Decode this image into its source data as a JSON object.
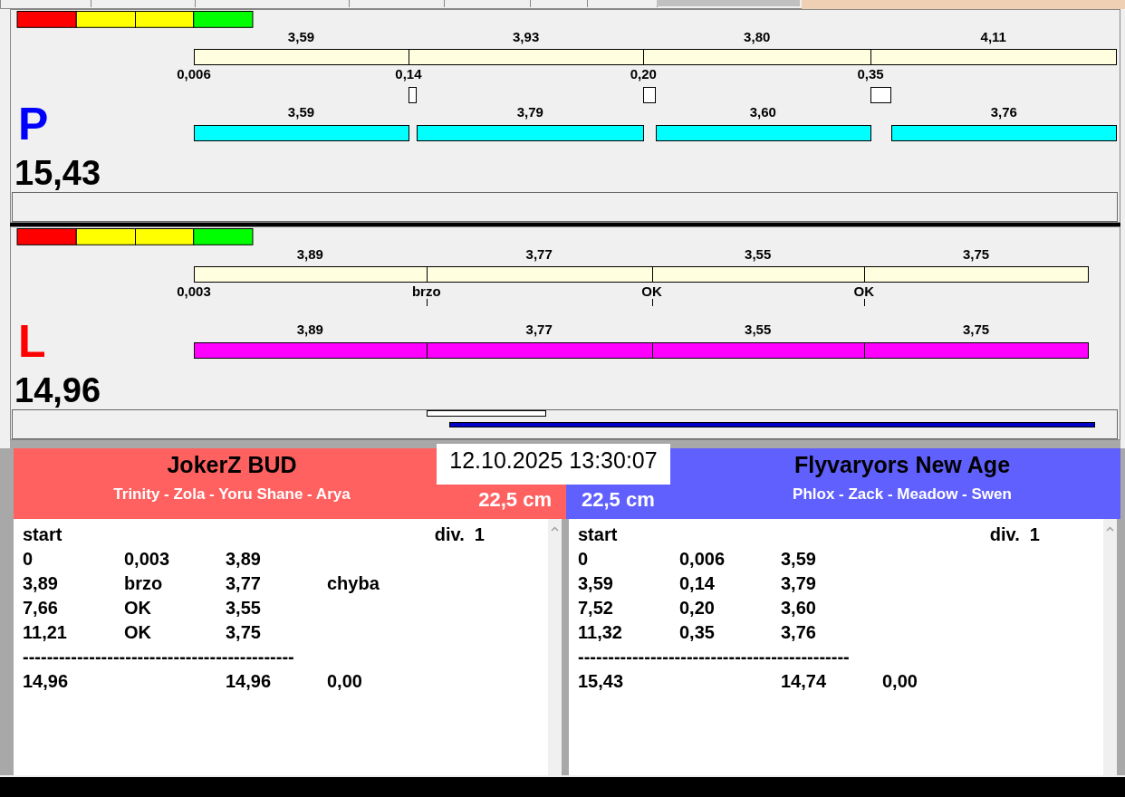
{
  "lanes": [
    {
      "letter": "P",
      "color": "#0000ff",
      "run_bar": {
        "color": "#00ffff"
      },
      "total": "15,43",
      "footer_marker": false,
      "legs": [
        {
          "split": "3,59",
          "reaction": "0,006",
          "run": "3,59"
        },
        {
          "split": "3,93",
          "reaction": "0,14",
          "run": "3,79"
        },
        {
          "split": "3,80",
          "reaction": "0,20",
          "run": "3,60"
        },
        {
          "split": "4,11",
          "reaction": "0,35",
          "run": "3,76"
        }
      ]
    },
    {
      "letter": "L",
      "color": "#ff0000",
      "run_bar": {
        "color": "#ff00ff"
      },
      "total": "14,96",
      "footer_marker": true,
      "legs": [
        {
          "split": "3,89",
          "reaction": "0,003",
          "run": "3,89"
        },
        {
          "split": "3,77",
          "reaction": "brzo",
          "run": "3,77"
        },
        {
          "split": "3,55",
          "reaction": "OK",
          "run": "3,55"
        },
        {
          "split": "3,75",
          "reaction": "OK",
          "run": "3,75"
        }
      ]
    }
  ],
  "datetime": "12.10.2025 13:30:07",
  "teams": [
    {
      "name": "JokerZ BUD",
      "members": "Trinity - Zola - Yoru Shane - Arya",
      "distance": "22,5 cm",
      "color": "#ff6060",
      "results": {
        "start": "start",
        "division": "div.  1",
        "rows": [
          [
            "0",
            "0,003",
            "3,89"
          ],
          [
            "3,89",
            "brzo",
            "3,77",
            "chyba"
          ],
          [
            "7,66",
            "OK",
            "3,55"
          ],
          [
            "11,21",
            "OK",
            "3,75"
          ]
        ],
        "separator": "---------------------------------------------",
        "totals": {
          "total": "14,96",
          "run_total": "14,96",
          "diff": "0,00"
        }
      }
    },
    {
      "name": "Flyvaryors New Age",
      "members": "Phlox - Zack - Meadow - Swen",
      "distance": "22,5 cm",
      "color": "#6060ff",
      "results": {
        "start": "start",
        "division": "div.  1",
        "rows": [
          [
            "0",
            "0,006",
            "3,59"
          ],
          [
            "3,59",
            "0,14",
            "3,79"
          ],
          [
            "7,52",
            "0,20",
            "3,60"
          ],
          [
            "11,32",
            "0,35",
            "3,76"
          ]
        ],
        "separator": "---------------------------------------------",
        "totals": {
          "total": "15,43",
          "run_total": "14,74",
          "diff": "0,00"
        }
      }
    }
  ]
}
